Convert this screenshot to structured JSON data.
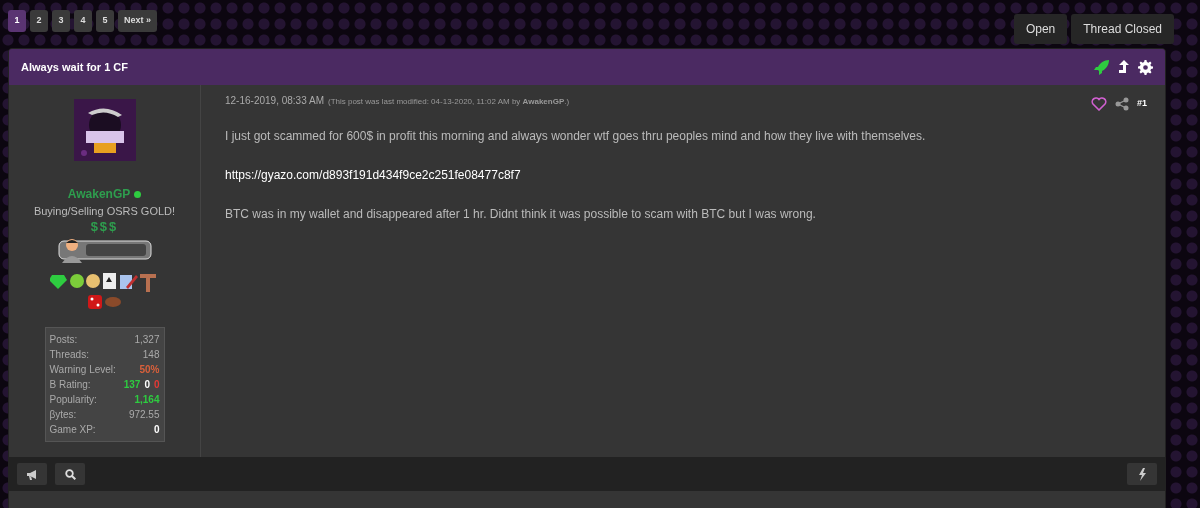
{
  "pagination": [
    {
      "label": "1",
      "selected": true
    },
    {
      "label": "2",
      "selected": false
    },
    {
      "label": "3",
      "selected": false
    },
    {
      "label": "4",
      "selected": false
    },
    {
      "label": "5",
      "selected": false
    },
    {
      "label": "Next »",
      "selected": false
    }
  ],
  "thread_buttons": [
    "Open",
    "Thread Closed"
  ],
  "thread": {
    "title": "Always wait for 1 CF"
  },
  "post": {
    "author": {
      "name": "AwakenGP",
      "online": true,
      "usertitle": "Buying/Selling OSRS GOLD!",
      "rank": "$$$",
      "stats": [
        {
          "label": "Posts:",
          "values": [
            {
              "text": "1,327",
              "color": "#aaaaaa"
            }
          ]
        },
        {
          "label": "Threads:",
          "values": [
            {
              "text": "148",
              "color": "#aaaaaa"
            }
          ]
        },
        {
          "label": "Warning Level:",
          "values": [
            {
              "text": "50%",
              "color": "#d9603b"
            }
          ]
        },
        {
          "label": "B Rating:",
          "values": [
            {
              "text": "137",
              "color": "#2ecc40"
            },
            {
              "text": "0",
              "color": "#ffffff"
            },
            {
              "text": "0",
              "color": "#e53935"
            }
          ]
        },
        {
          "label": "Popularity:",
          "values": [
            {
              "text": "1,164",
              "color": "#2ecc40"
            }
          ]
        },
        {
          "label": "βytes:",
          "values": [
            {
              "text": "972.55",
              "color": "#aaaaaa"
            }
          ]
        },
        {
          "label": "Game XP:",
          "values": [
            {
              "text": "0",
              "color": "#ffffff"
            }
          ]
        }
      ]
    },
    "date": "12-16-2019, 08:33 AM",
    "edit_note": "(This post was last modified: 04-13-2020, 11:02 AM by **AwakenGP**.)",
    "liked": false,
    "number": "#1",
    "body": [
      {
        "kind": "text",
        "text": "I just got scammed for 600$ in profit this morning and always wonder wtf goes thru peoples mind and how they live with themselves."
      },
      {
        "kind": "link",
        "text": "https://gyazo.com/d893f191d434f9ce2c251fe08477c8f7"
      },
      {
        "kind": "text",
        "text": "BTC was in my wallet and disappeared after 1 hr. Didnt think it was possible to scam with BTC but I was wrong."
      }
    ]
  }
}
